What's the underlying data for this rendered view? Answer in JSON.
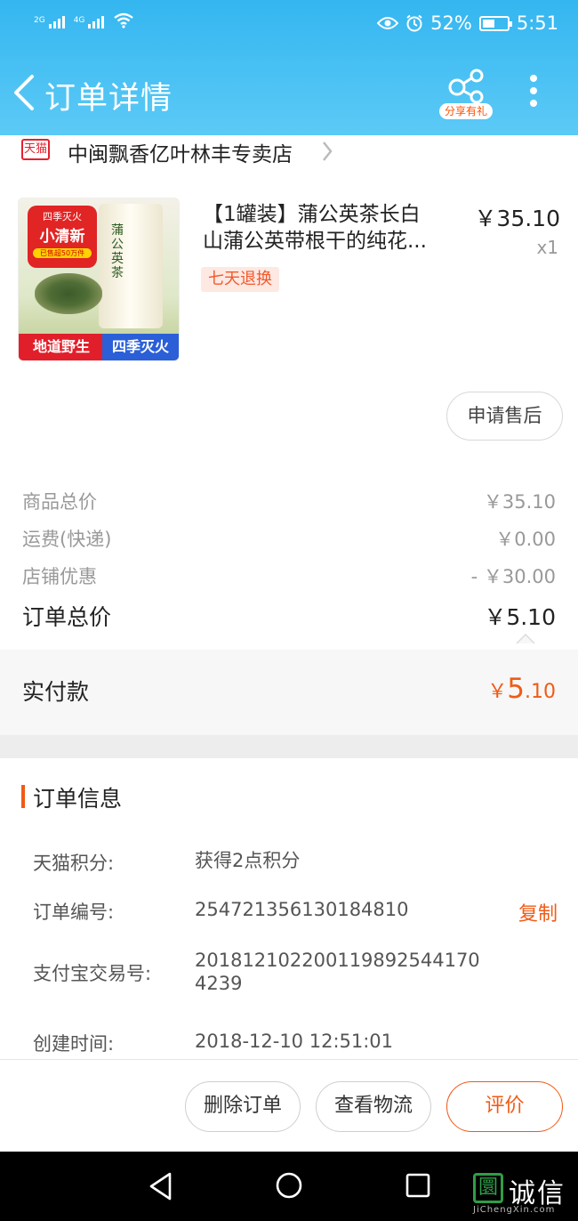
{
  "status_bar": {
    "net1": "2G",
    "net2": "4G",
    "battery_pct": "52%",
    "battery_level": 0.52,
    "time": "5:51"
  },
  "nav": {
    "title": "订单详情",
    "share_label": "分享有礼",
    "icons": [
      "back-arrow-icon",
      "share-icon",
      "more-vertical-icon"
    ]
  },
  "shop": {
    "badge": "天猫",
    "name": "中闽飘香亿叶林丰专卖店"
  },
  "product": {
    "title_line1": "【1罐装】蒲公英茶长白",
    "title_line2": "山蒲公英带根干的纯花...",
    "price": "￥35.10",
    "qty": "x1",
    "return_badge": "七天退换",
    "thumb": {
      "tag_top": "四季灭火",
      "tag_main": "小清新",
      "tag_sub": "已售超50万件",
      "can_text": "蒲公英茶",
      "bottom_left": "地道野生",
      "bottom_right": "四季灭火"
    }
  },
  "after_sale_button": "申请售后",
  "summary": {
    "rows": [
      {
        "label": "商品总价",
        "value": "￥35.10"
      },
      {
        "label": "运费(快递)",
        "value": "￥0.00"
      },
      {
        "label": "店铺优惠",
        "value": "- ￥30.00"
      }
    ],
    "total_label": "订单总价",
    "total_value": "￥5.10"
  },
  "paid": {
    "label": "实付款",
    "currency": "￥",
    "integer": "5",
    "decimal": ".10"
  },
  "order_info": {
    "heading": "订单信息",
    "rows": [
      {
        "label": "天猫积分:",
        "value": "获得2点积分"
      },
      {
        "label": "订单编号:",
        "value": "254721356130184810",
        "action": "复制"
      },
      {
        "label": "支付宝交易号:",
        "value": "2018121022001198925441704239"
      },
      {
        "label": "创建时间:",
        "value": "2018-12-10 12:51:01"
      }
    ]
  },
  "footer": {
    "delete": "删除订单",
    "logistics": "查看物流",
    "rate": "评价"
  },
  "watermark": {
    "zh": "诚信",
    "mark": "圜",
    "en": "JiChengXin.com"
  }
}
